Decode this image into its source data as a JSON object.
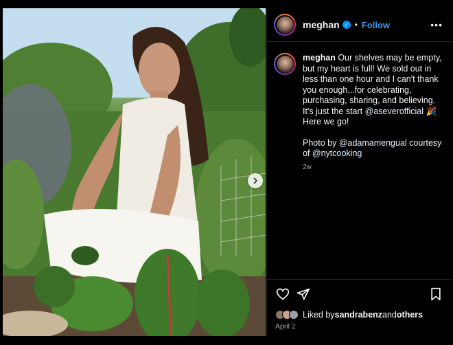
{
  "post": {
    "username": "meghan",
    "verified_mark": "✓",
    "separator": "•",
    "follow_label": "Follow",
    "more_label": "•••",
    "caption": {
      "username": "meghan",
      "text_1": " Our shelves may be empty, but my heart is full! We sold out in less than one hour and I can't thank you enough...for celebrating, purchasing, sharing, and believing. It's just the start ",
      "mention_1": "@aseverofficial",
      "emoji": "🎉",
      "text_2": " Here we go!",
      "photo_prefix": "Photo by ",
      "mention_2": "@adamamengual",
      "photo_mid": " courtesy of ",
      "mention_3": "@nytcooking"
    },
    "age": "2w",
    "likes_prefix": "Liked by ",
    "likes_user": "sandrabenz",
    "likes_and": " and ",
    "likes_others": "others",
    "date": "April 2"
  },
  "icons": {
    "like": "heart-icon",
    "share": "send-icon",
    "save": "bookmark-icon",
    "next": "chevron-right-icon",
    "more": "more-options-icon"
  },
  "colors": {
    "background": "#000000",
    "follow": "#3897f0",
    "verified": "#0095f6",
    "muted_text": "#a8a8a8"
  }
}
